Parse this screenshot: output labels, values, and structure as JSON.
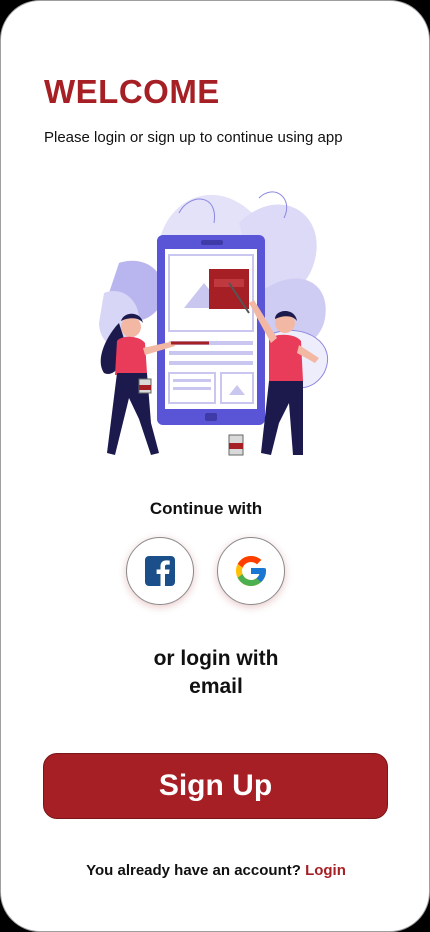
{
  "header": {
    "title": "WELCOME",
    "subtitle": "Please login or sign up to continue using app"
  },
  "illustration": {
    "name": "people-painting-phone-illustration"
  },
  "social": {
    "heading": "Continue with",
    "facebook_icon": "facebook-icon",
    "google_icon": "google-icon"
  },
  "email": {
    "label": "or login with email"
  },
  "actions": {
    "signup_label": "Sign Up"
  },
  "footer": {
    "prompt": "You already have an account?",
    "login_link": "Login"
  },
  "colors": {
    "accent": "#a51f24",
    "background": "#ffffff",
    "illustration_purple": "#5a55d6"
  }
}
